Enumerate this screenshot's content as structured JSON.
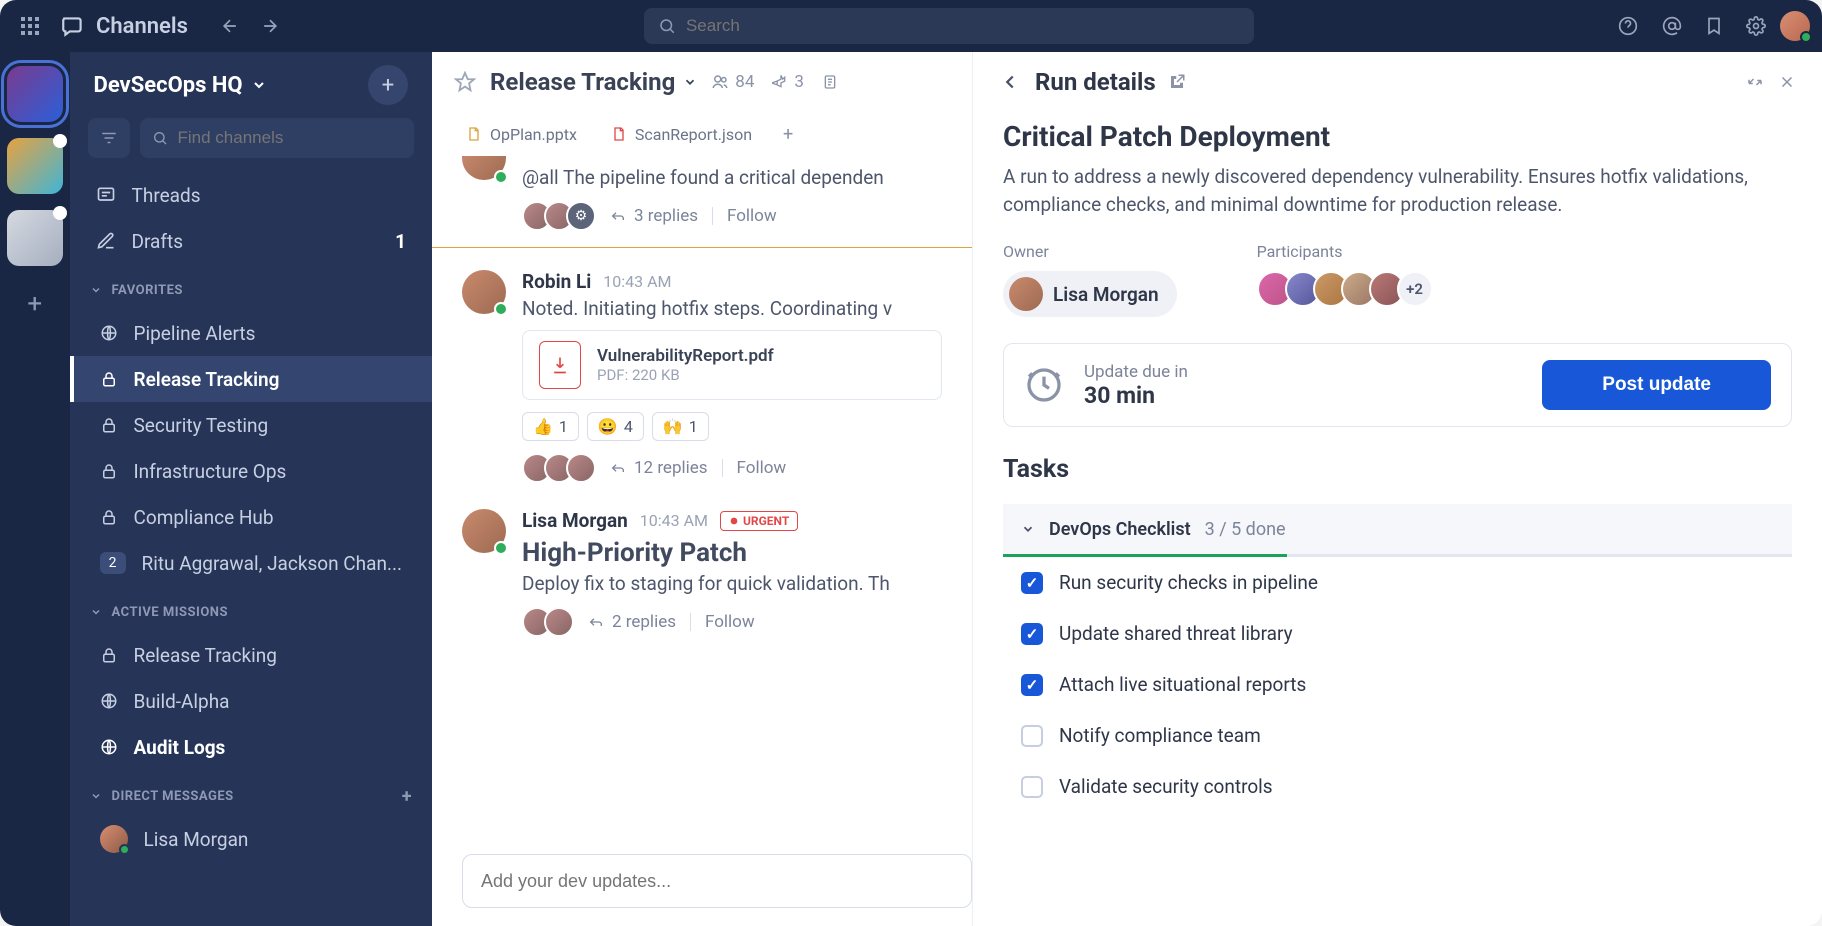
{
  "topbar": {
    "channels_label": "Channels",
    "search_placeholder": "Search"
  },
  "workspace": {
    "name": "DevSecOps HQ",
    "find_placeholder": "Find channels"
  },
  "nav": {
    "threads": "Threads",
    "drafts": "Drafts",
    "drafts_count": "1"
  },
  "sections": {
    "favorites": "FAVORITES",
    "active_missions": "ACTIVE MISSIONS",
    "direct_messages": "DIRECT MESSAGES"
  },
  "favorites": [
    {
      "icon": "globe",
      "label": "Pipeline Alerts"
    },
    {
      "icon": "lock",
      "label": "Release Tracking",
      "active": true
    },
    {
      "icon": "lock",
      "label": "Security Testing"
    },
    {
      "icon": "lock",
      "label": "Infrastructure Ops"
    },
    {
      "icon": "lock",
      "label": "Compliance Hub"
    },
    {
      "icon": "badge",
      "label": "Ritu Aggrawal, Jackson Chan...",
      "badge": "2"
    }
  ],
  "missions": [
    {
      "icon": "lock",
      "label": "Release Tracking"
    },
    {
      "icon": "globe",
      "label": "Build-Alpha"
    },
    {
      "icon": "globe",
      "label": "Audit Logs",
      "bold": true
    }
  ],
  "dms": [
    {
      "label": "Lisa Morgan"
    }
  ],
  "feed": {
    "title": "Release Tracking",
    "members": "84",
    "pinned": "3",
    "tabs": [
      {
        "label": "OpPlan.pptx",
        "color": "#d9a441"
      },
      {
        "label": "ScanReport.json",
        "color": "#e04848"
      }
    ],
    "composer_placeholder": "Add your dev updates..."
  },
  "messages": [
    {
      "text": "@all The pipeline found a critical dependen",
      "replies": "3 replies",
      "follow": "Follow",
      "reply_avatars": 3,
      "bot_last": true
    },
    {
      "author": "Robin Li",
      "time": "10:43 AM",
      "text": "Noted. Initiating hotfix steps. Coordinating v",
      "attachment": {
        "name": "VulnerabilityReport.pdf",
        "meta": "PDF: 220 KB"
      },
      "reactions": [
        {
          "emoji": "👍",
          "count": "1"
        },
        {
          "emoji": "😀",
          "count": "4"
        },
        {
          "emoji": "🙌",
          "count": "1"
        }
      ],
      "replies": "12 replies",
      "follow": "Follow",
      "reply_avatars": 3
    },
    {
      "author": "Lisa Morgan",
      "time": "10:43 AM",
      "urgent": "URGENT",
      "title_big": "High-Priority Patch",
      "text": "Deploy fix to staging for quick validation. Th",
      "replies": "2 replies",
      "follow": "Follow",
      "reply_avatars": 2
    }
  ],
  "panel": {
    "title": "Run details",
    "run_title": "Critical Patch Deployment",
    "run_desc": "A run to address a newly discovered dependency vulnerability. Ensures hotfix validations, compliance checks, and minimal downtime for production release.",
    "owner_label": "Owner",
    "owner_name": "Lisa Morgan",
    "participants_label": "Participants",
    "participants_extra": "+2",
    "update_label": "Update due in",
    "update_value": "30 min",
    "post_button": "Post update",
    "tasks_title": "Tasks",
    "checklist_name": "DevOps Checklist",
    "checklist_count": "3 / 5 done",
    "tasks": [
      {
        "label": "Run security checks in pipeline",
        "done": true
      },
      {
        "label": "Update shared threat library",
        "done": true
      },
      {
        "label": "Attach live situational reports",
        "done": true
      },
      {
        "label": "Notify compliance team",
        "done": false
      },
      {
        "label": "Validate security controls",
        "done": false
      }
    ]
  }
}
